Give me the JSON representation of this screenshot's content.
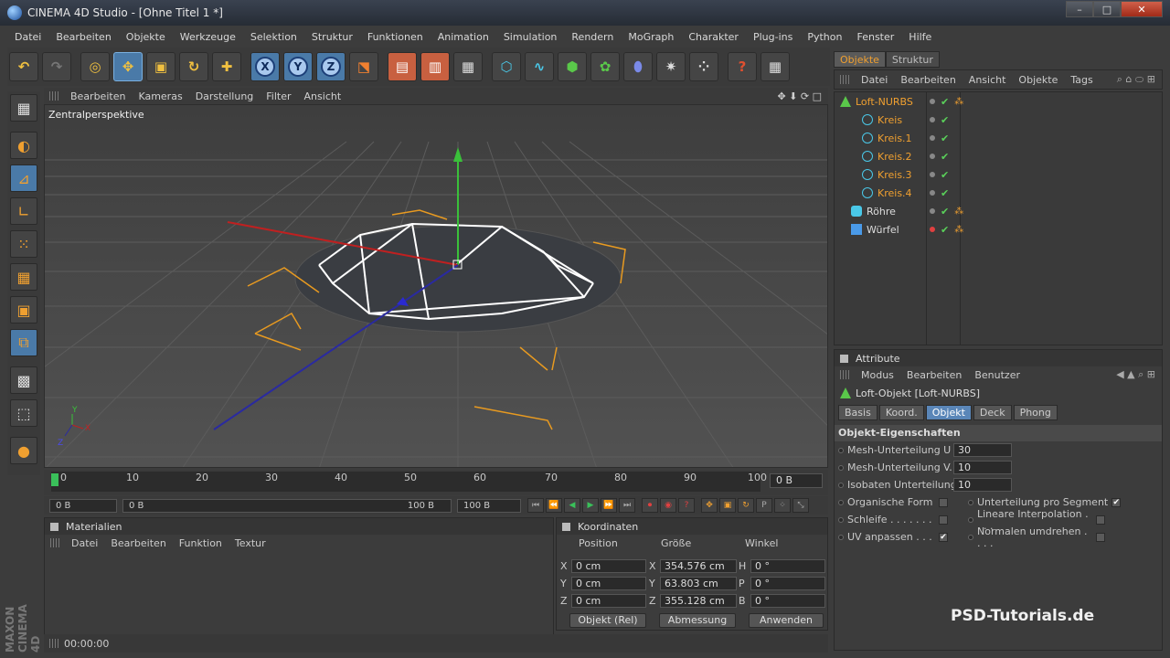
{
  "window": {
    "title": "CINEMA 4D Studio - [Ohne Titel 1 *]",
    "min": "–",
    "max": "□",
    "close": "✕"
  },
  "menubar": [
    "Datei",
    "Bearbeiten",
    "Objekte",
    "Werkzeuge",
    "Selektion",
    "Struktur",
    "Funktionen",
    "Animation",
    "Simulation",
    "Rendern",
    "MoGraph",
    "Charakter",
    "Plug-ins",
    "Python",
    "Fenster",
    "Hilfe"
  ],
  "toolbar": {
    "axis_x": "X",
    "axis_y": "Y",
    "axis_z": "Z"
  },
  "viewport": {
    "menu": [
      "Bearbeiten",
      "Kameras",
      "Darstellung",
      "Filter",
      "Ansicht"
    ],
    "label": "Zentralperspektive",
    "nav": "✥ ⬇ ⟳ □",
    "axis_y": "Y",
    "axis_x": "X",
    "axis_z": "Z"
  },
  "timeline": {
    "ticks": [
      "0",
      "10",
      "20",
      "30",
      "40",
      "50",
      "60",
      "70",
      "80",
      "90",
      "100"
    ],
    "current_frame": "0 B"
  },
  "transport": {
    "start": "0 B",
    "range_start": "0 B",
    "range_end": "100 B",
    "end": "100 B"
  },
  "objects_panel": {
    "tabs": [
      "Objekte",
      "Struktur"
    ],
    "menu": [
      "Datei",
      "Bearbeiten",
      "Ansicht",
      "Objekte",
      "Tags"
    ],
    "items": [
      {
        "name": "Loft-NURBS",
        "indent": 0,
        "highlight": true
      },
      {
        "name": "Kreis",
        "indent": 1,
        "highlight": true
      },
      {
        "name": "Kreis.1",
        "indent": 1,
        "highlight": true
      },
      {
        "name": "Kreis.2",
        "indent": 1,
        "highlight": true
      },
      {
        "name": "Kreis.3",
        "indent": 1,
        "highlight": true
      },
      {
        "name": "Kreis.4",
        "indent": 1,
        "highlight": true
      },
      {
        "name": "Röhre",
        "indent": 0,
        "highlight": false
      },
      {
        "name": "Würfel",
        "indent": 0,
        "highlight": false
      }
    ]
  },
  "attributes": {
    "header": "Attribute",
    "menu": [
      "Modus",
      "Bearbeiten",
      "Benutzer"
    ],
    "object_title": "Loft-Objekt [Loft-NURBS]",
    "tabs": [
      "Basis",
      "Koord.",
      "Objekt",
      "Deck",
      "Phong"
    ],
    "active_tab": "Objekt",
    "section": "Objekt-Eigenschaften",
    "mesh_u_label": "Mesh-Unterteilung U",
    "mesh_u_value": "30",
    "mesh_v_label": "Mesh-Unterteilung V. . .",
    "mesh_v_value": "10",
    "iso_u_label": "Isobaten Unterteilung U",
    "iso_u_value": "10",
    "organic": "Organische Form",
    "seg": "Unterteilung pro Segment",
    "loop": "Schleife . . . . . . .",
    "linear": "Lineare Interpolation . . . .",
    "uv": "UV anpassen . . .",
    "normals": "Normalen umdrehen . . . ."
  },
  "materials": {
    "header": "Materialien",
    "menu": [
      "Datei",
      "Bearbeiten",
      "Funktion",
      "Textur"
    ]
  },
  "coordinates": {
    "header": "Koordinaten",
    "col_position": "Position",
    "col_size": "Größe",
    "col_angle": "Winkel",
    "rows": [
      {
        "axis": "X",
        "pos": "0 cm",
        "size_axis": "X",
        "size": "354.576 cm",
        "rot_axis": "H",
        "rot": "0 °"
      },
      {
        "axis": "Y",
        "pos": "0 cm",
        "size_axis": "Y",
        "size": "63.803 cm",
        "rot_axis": "P",
        "rot": "0 °"
      },
      {
        "axis": "Z",
        "pos": "0 cm",
        "size_axis": "Z",
        "size": "355.128 cm",
        "rot_axis": "B",
        "rot": "0 °"
      }
    ],
    "btn_mode": "Objekt (Rel)",
    "btn_measure": "Abmessung",
    "btn_apply": "Anwenden"
  },
  "status": {
    "time": "00:00:00"
  },
  "branding": {
    "maxon": "MAXON CINEMA 4D",
    "watermark": "PSD-Tutorials.de"
  }
}
